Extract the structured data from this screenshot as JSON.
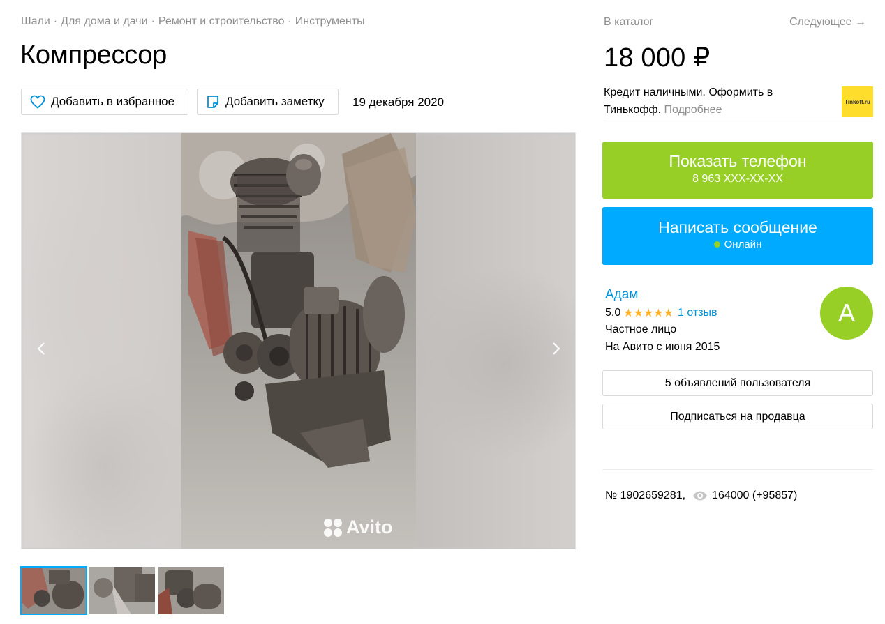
{
  "breadcrumbs": [
    "Шали",
    "Для дома и дачи",
    "Ремонт и строительство",
    "Инструменты"
  ],
  "breadcrumb_separator": "·",
  "title": "Компрессор",
  "actions": {
    "favorite_label": "Добавить в избранное",
    "note_label": "Добавить заметку",
    "date": "19 декабря 2020"
  },
  "gallery": {
    "watermark": "Avito",
    "thumbnails_count": 3,
    "active_thumbnail": 1
  },
  "nav": {
    "catalog": "В каталог",
    "next": "Следующее →"
  },
  "price": "18 000 ₽",
  "credit": {
    "text": "Кредит наличными. Оформить в Тинькофф.",
    "more": "Подробнее",
    "logo_text": "Tinkoff.ru"
  },
  "contact": {
    "phone_label": "Показать телефон",
    "phone_masked": "8 963 XXX-XX-XX",
    "message_label": "Написать сообщение",
    "status": "Онлайн"
  },
  "seller": {
    "name": "Адам",
    "rating": "5,0",
    "stars": "★★★★★",
    "reviews": "1 отзыв",
    "type": "Частное лицо",
    "since": "На Авито с июня 2015",
    "avatar_letter": "А"
  },
  "seller_actions": {
    "ads": "5 объявлений пользователя",
    "subscribe": "Подписаться на продавца"
  },
  "listing": {
    "number": "№ 1902659281,",
    "views": "164000 (+95857)"
  },
  "colors": {
    "green": "#97cf26",
    "blue": "#00aaff",
    "link": "#0091d9",
    "star": "#ffb021",
    "muted": "#8f8f8f"
  }
}
